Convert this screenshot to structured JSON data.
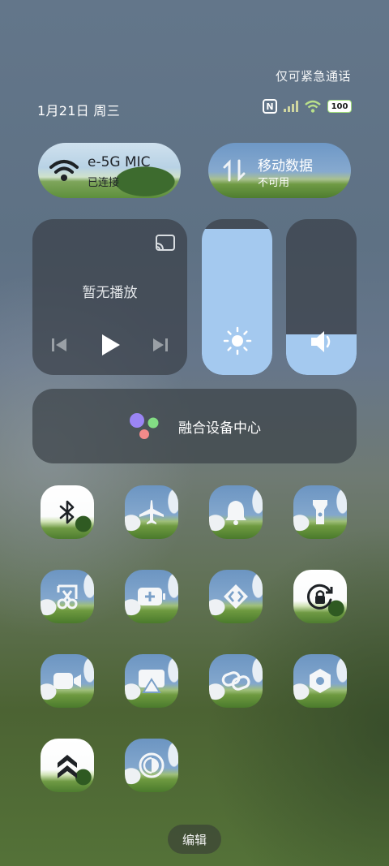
{
  "header": {
    "emergency_text": "仅可紧急通话",
    "date": "1月21日 周三",
    "battery": "100"
  },
  "wifi": {
    "title": "e-5G    MIC",
    "status": "已连接"
  },
  "mobile_data": {
    "title": "移动数据",
    "status": "不可用"
  },
  "media": {
    "status": "暂无播放"
  },
  "brightness": {
    "level_percent": 94
  },
  "volume": {
    "level_percent": 26
  },
  "hub": {
    "label": "融合设备中心"
  },
  "toggles": [
    {
      "icon": "bluetooth-icon",
      "state": "on"
    },
    {
      "icon": "airplane-icon",
      "state": "off"
    },
    {
      "icon": "bell-icon",
      "state": "off"
    },
    {
      "icon": "flashlight-icon",
      "state": "off"
    },
    {
      "icon": "screenshot-icon",
      "state": "off"
    },
    {
      "icon": "battery-saver-icon",
      "state": "off"
    },
    {
      "icon": "screen-cast-icon",
      "state": "off"
    },
    {
      "icon": "rotation-lock-icon",
      "state": "on"
    },
    {
      "icon": "screen-record-icon",
      "state": "off"
    },
    {
      "icon": "projection-icon",
      "state": "off"
    },
    {
      "icon": "link-icon",
      "state": "off"
    },
    {
      "icon": "hexagon-settings-icon",
      "state": "off"
    },
    {
      "icon": "boost-icon",
      "state": "on"
    },
    {
      "icon": "contrast-icon",
      "state": "off"
    }
  ],
  "edit": {
    "label": "编辑"
  }
}
